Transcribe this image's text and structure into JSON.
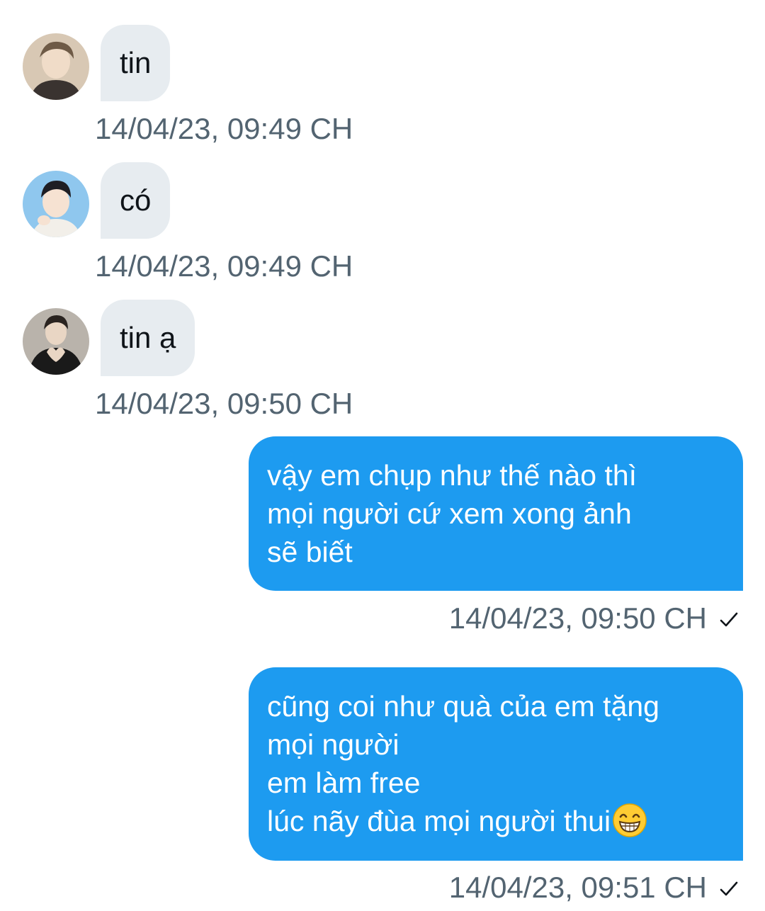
{
  "messages": [
    {
      "direction": "incoming",
      "avatar": "avatar-user-1",
      "text": "tin",
      "time": "14/04/23, 09:49 CH"
    },
    {
      "direction": "incoming",
      "avatar": "avatar-user-2",
      "text": "có",
      "time": "14/04/23, 09:49 CH"
    },
    {
      "direction": "incoming",
      "avatar": "avatar-user-3",
      "text": "tin ạ",
      "time": "14/04/23, 09:50 CH"
    },
    {
      "direction": "outgoing",
      "lines": [
        "vậy em chụp như thế nào thì",
        "mọi người cứ xem xong ảnh",
        "sẽ biết"
      ],
      "time": "14/04/23, 09:50 CH",
      "status_icon": "check-icon"
    },
    {
      "direction": "outgoing",
      "lines": [
        "cũng coi như quà của em tặng",
        "mọi người",
        "em làm free",
        "lúc nãy đùa mọi người thui"
      ],
      "trailing_emoji": "grinning-face-emoji",
      "time": "14/04/23, 09:51 CH",
      "status_icon": "check-icon"
    }
  ],
  "colors": {
    "incoming_bubble": "#e7ecf0",
    "outgoing_bubble": "#1d9bf0",
    "timestamp": "#536471",
    "text_dark": "#0f1419"
  }
}
